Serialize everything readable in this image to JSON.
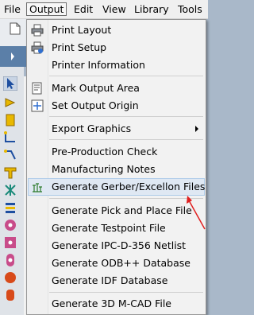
{
  "menubar": {
    "items": [
      "File",
      "Output",
      "Edit",
      "View",
      "Library",
      "Tools"
    ],
    "active": "Output"
  },
  "menu": {
    "items": [
      {
        "label": "Print Layout",
        "icon": "printer-icon"
      },
      {
        "label": "Print Setup",
        "icon": "printer-setup-icon"
      },
      {
        "label": "Printer Information",
        "icon": "none"
      },
      {
        "label": "Mark Output Area",
        "icon": "mark-area-icon"
      },
      {
        "label": "Set Output Origin",
        "icon": "origin-icon"
      },
      {
        "label": "Export Graphics",
        "icon": "none",
        "submenu": true
      },
      {
        "label": "Pre-Production Check",
        "icon": "none"
      },
      {
        "label": "Manufacturing Notes",
        "icon": "none"
      },
      {
        "label": "Generate Gerber/Excellon Files",
        "icon": "gerber-icon",
        "highlighted": true
      },
      {
        "label": "Generate Pick and Place File",
        "icon": "none"
      },
      {
        "label": "Generate Testpoint File",
        "icon": "none"
      },
      {
        "label": "Generate IPC-D-356 Netlist",
        "icon": "none"
      },
      {
        "label": "Generate ODB++ Database",
        "icon": "none"
      },
      {
        "label": "Generate IDF Database",
        "icon": "none"
      },
      {
        "label": "Generate 3D M-CAD File",
        "icon": "none"
      }
    ]
  },
  "colors": {
    "highlight": "#dfe8f3",
    "annotation_arrow": "#e02020"
  }
}
